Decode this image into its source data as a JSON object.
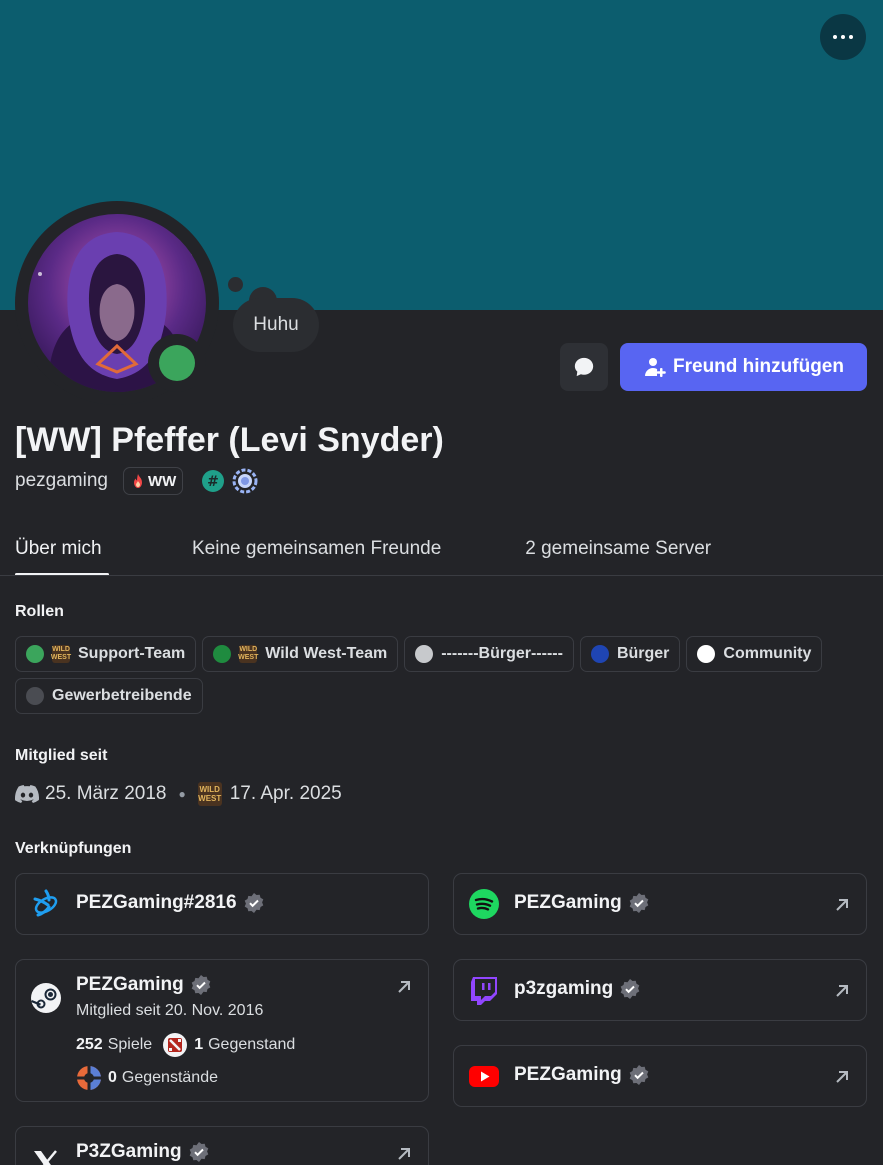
{
  "status_bubble": "Huhu",
  "actions": {
    "add_friend": "Freund hinzufügen"
  },
  "profile": {
    "display_name": "[WW] Pfeffer (Levi Snyder)",
    "username": "pezgaming",
    "server_tag": "WW"
  },
  "tabs": [
    {
      "label": "Über mich",
      "active": true
    },
    {
      "label": "Keine gemeinsamen Freunde",
      "active": false
    },
    {
      "label": "2 gemeinsame Server",
      "active": false
    }
  ],
  "roles_heading": "Rollen",
  "roles": [
    {
      "label": "Support-Team",
      "color": "#3ba55c",
      "icon": true
    },
    {
      "label": "Wild West-Team",
      "color": "#1f8b3f",
      "icon": true
    },
    {
      "label": "-------Bürger------",
      "color": "#c7c9cc",
      "icon": false
    },
    {
      "label": "Bürger",
      "color": "#1f45b3",
      "icon": false
    },
    {
      "label": "Community",
      "color": "#ffffff",
      "icon": false
    },
    {
      "label": "Gewerbetreibende",
      "color": "#4a4c52",
      "icon": false
    }
  ],
  "member_since": {
    "heading": "Mitglied seit",
    "discord_date": "25. März 2018",
    "server_date": "17. Apr. 2025"
  },
  "connections_heading": "Verknüpfungen",
  "connections": {
    "battlenet": {
      "name": "PEZGaming#2816"
    },
    "spotify": {
      "name": "PEZGaming"
    },
    "steam": {
      "name": "PEZGaming",
      "since": "Mitglied seit 20. Nov. 2016",
      "games_count": "252",
      "games_label": "Spiele",
      "dota_count": "1",
      "dota_label": "Gegenstand",
      "tf2_count": "0",
      "tf2_label": "Gegenstände"
    },
    "twitch": {
      "name": "p3zgaming"
    },
    "youtube": {
      "name": "PEZGaming"
    },
    "x": {
      "name": "P3ZGaming"
    }
  },
  "colors": {
    "banner": "#0c5d6e",
    "accent": "#5865f2",
    "online": "#3ba55c"
  }
}
